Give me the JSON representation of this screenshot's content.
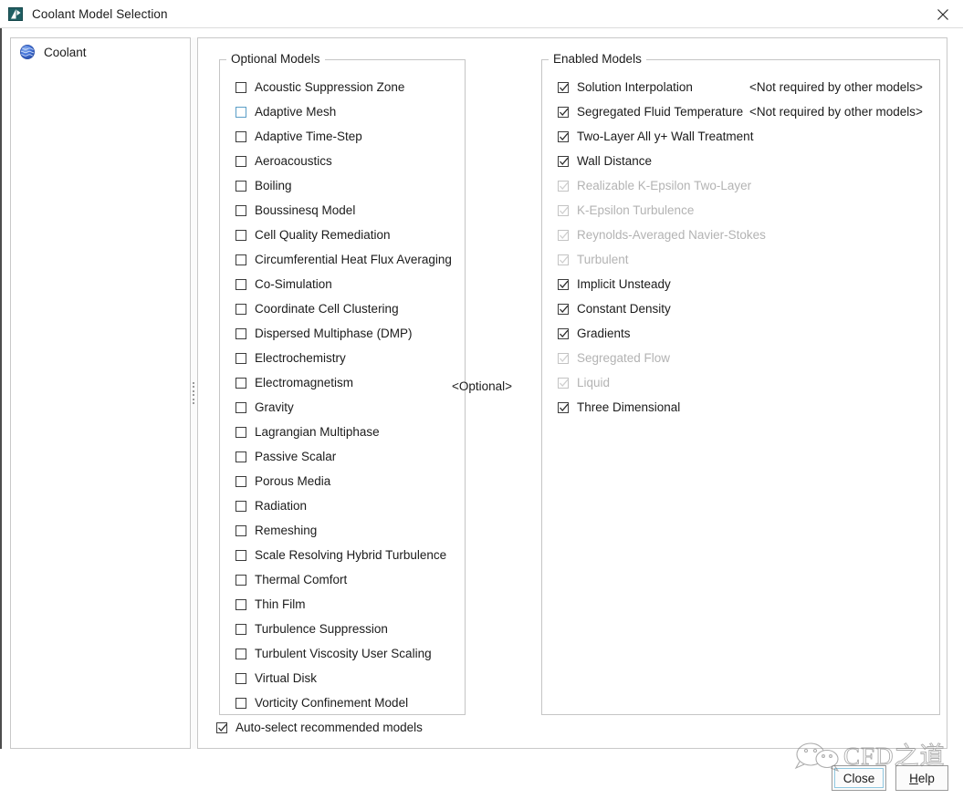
{
  "window": {
    "title": "Coolant Model Selection",
    "icon": "app-icon",
    "close_icon": "close-icon"
  },
  "sidebar": {
    "items": [
      {
        "label": "Coolant",
        "icon": "coolant-sphere-icon"
      }
    ]
  },
  "middle": {
    "optional_tag": "<Optional>"
  },
  "optional_models": {
    "title": "Optional Models",
    "items": [
      {
        "label": "Acoustic Suppression Zone",
        "checked": false,
        "hover": false
      },
      {
        "label": "Adaptive Mesh",
        "checked": false,
        "hover": true
      },
      {
        "label": "Adaptive Time-Step",
        "checked": false,
        "hover": false
      },
      {
        "label": "Aeroacoustics",
        "checked": false,
        "hover": false
      },
      {
        "label": "Boiling",
        "checked": false,
        "hover": false
      },
      {
        "label": "Boussinesq Model",
        "checked": false,
        "hover": false
      },
      {
        "label": "Cell Quality Remediation",
        "checked": false,
        "hover": false
      },
      {
        "label": "Circumferential Heat Flux Averaging",
        "checked": false,
        "hover": false
      },
      {
        "label": "Co-Simulation",
        "checked": false,
        "hover": false
      },
      {
        "label": "Coordinate Cell Clustering",
        "checked": false,
        "hover": false
      },
      {
        "label": "Dispersed Multiphase (DMP)",
        "checked": false,
        "hover": false
      },
      {
        "label": "Electrochemistry",
        "checked": false,
        "hover": false
      },
      {
        "label": "Electromagnetism",
        "checked": false,
        "hover": false
      },
      {
        "label": "Gravity",
        "checked": false,
        "hover": false
      },
      {
        "label": "Lagrangian Multiphase",
        "checked": false,
        "hover": false
      },
      {
        "label": "Passive Scalar",
        "checked": false,
        "hover": false
      },
      {
        "label": "Porous Media",
        "checked": false,
        "hover": false
      },
      {
        "label": "Radiation",
        "checked": false,
        "hover": false
      },
      {
        "label": "Remeshing",
        "checked": false,
        "hover": false
      },
      {
        "label": "Scale Resolving Hybrid Turbulence",
        "checked": false,
        "hover": false
      },
      {
        "label": "Thermal Comfort",
        "checked": false,
        "hover": false
      },
      {
        "label": "Thin Film",
        "checked": false,
        "hover": false
      },
      {
        "label": "Turbulence Suppression",
        "checked": false,
        "hover": false
      },
      {
        "label": "Turbulent Viscosity User Scaling",
        "checked": false,
        "hover": false
      },
      {
        "label": "Virtual Disk",
        "checked": false,
        "hover": false
      },
      {
        "label": "Vorticity Confinement Model",
        "checked": false,
        "hover": false
      }
    ]
  },
  "enabled_models": {
    "title": "Enabled Models",
    "items": [
      {
        "label": "Solution Interpolation",
        "checked": true,
        "disabled": false,
        "note": "<Not required by other models>"
      },
      {
        "label": "Segregated Fluid Temperature",
        "checked": true,
        "disabled": false,
        "note": "<Not required by other models>"
      },
      {
        "label": "Two-Layer All y+ Wall Treatment",
        "checked": true,
        "disabled": false,
        "note": ""
      },
      {
        "label": "Wall Distance",
        "checked": true,
        "disabled": false,
        "note": ""
      },
      {
        "label": "Realizable K-Epsilon Two-Layer",
        "checked": true,
        "disabled": true,
        "note": ""
      },
      {
        "label": "K-Epsilon Turbulence",
        "checked": true,
        "disabled": true,
        "note": ""
      },
      {
        "label": "Reynolds-Averaged Navier-Stokes",
        "checked": true,
        "disabled": true,
        "note": ""
      },
      {
        "label": "Turbulent",
        "checked": true,
        "disabled": true,
        "note": ""
      },
      {
        "label": "Implicit Unsteady",
        "checked": true,
        "disabled": false,
        "note": ""
      },
      {
        "label": "Constant Density",
        "checked": true,
        "disabled": false,
        "note": ""
      },
      {
        "label": "Gradients",
        "checked": true,
        "disabled": false,
        "note": ""
      },
      {
        "label": "Segregated Flow",
        "checked": true,
        "disabled": true,
        "note": ""
      },
      {
        "label": "Liquid",
        "checked": true,
        "disabled": true,
        "note": ""
      },
      {
        "label": "Three Dimensional",
        "checked": true,
        "disabled": false,
        "note": ""
      }
    ]
  },
  "auto_select": {
    "label": "Auto-select recommended models",
    "checked": true
  },
  "footer": {
    "close_label": "Close",
    "help_label_prefix": "H",
    "help_label_rest": "elp"
  },
  "watermark": {
    "text": "CFD之道"
  },
  "colors": {
    "accent": "#3a6fd8",
    "border": "#c5c5c5",
    "text": "#1b1b1b",
    "disabled_text": "#b3b3b3",
    "focus_ring": "#8fc7e0"
  }
}
